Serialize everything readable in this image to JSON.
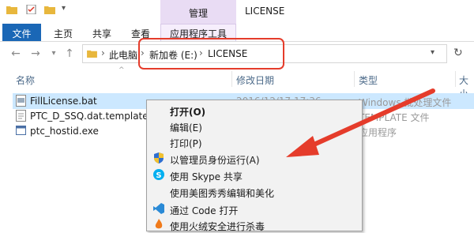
{
  "titlebar": {
    "manage_label": "管理",
    "window_title": "LICENSE"
  },
  "ribbon": {
    "file": "文件",
    "home": "主页",
    "share": "共享",
    "view": "查看",
    "app_tools": "应用程序工具"
  },
  "address": {
    "this_pc": "此电脑",
    "drive": "新加卷 (E:)",
    "folder": "LICENSE",
    "sep": "›"
  },
  "columns": {
    "name": "名称",
    "modified": "修改日期",
    "type": "类型",
    "size": "大小"
  },
  "files": [
    {
      "name": "FillLicense.bat",
      "modified": "2016/12/17 17:36",
      "type": "Windows 批处理文件",
      "selected": true,
      "icon": "bat-file-icon"
    },
    {
      "name": "PTC_D_SSQ.dat.template",
      "modified": "",
      "type": "TEMPLATE 文件",
      "selected": false,
      "icon": "template-file-icon"
    },
    {
      "name": "ptc_hostid.exe",
      "modified": "",
      "type": "应用程序",
      "selected": false,
      "icon": "exe-file-icon"
    }
  ],
  "context_menu": {
    "open": "打开(O)",
    "edit": "编辑(E)",
    "print": "打印(P)",
    "run_as_admin": "以管理员身份运行(A)",
    "skype_share": "使用 Skype 共享",
    "meitu_edit": "使用美图秀秀编辑和美化",
    "open_with_code": "通过 Code 打开",
    "huorong_scan": "使用火绒安全进行杀毒"
  },
  "colors": {
    "accent": "#1a67b6",
    "selection": "#cce8ff",
    "highlight": "#e53c2b",
    "manage_tab": "#e9dcf4"
  }
}
